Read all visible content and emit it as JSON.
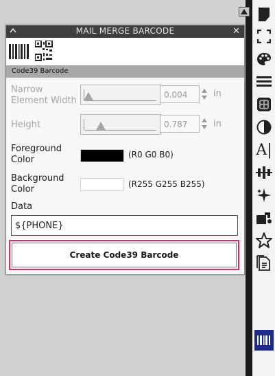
{
  "panel": {
    "title": "MAIL MERGE BARCODE",
    "type_label": "Code39 Barcode",
    "narrow": {
      "label": "Narrow Element Width",
      "value": "0.004",
      "unit": "in",
      "slider_fraction": 0.05
    },
    "height": {
      "label": "Height",
      "value": "0.787",
      "unit": "in",
      "slider_fraction": 0.2
    },
    "foreground": {
      "label": "Foreground Color",
      "color": "#000000",
      "rgb_text": "(R0 G0 B0)"
    },
    "background": {
      "label": "Background Color",
      "color": "#ffffff",
      "rgb_text": "(R255 G255 B255)"
    },
    "data_label": "Data",
    "data_value": "${PHONE}",
    "create_button": "Create Code39 Barcode"
  },
  "toolbar": {
    "icons": [
      "page-icon",
      "crop-icon",
      "palette-icon",
      "lines-icon",
      "texture-icon",
      "contrast-icon",
      "text-icon",
      "align-icon",
      "sparkle-icon",
      "fill-icon",
      "star-icon",
      "document-icon",
      "barcode-icon"
    ],
    "text_glyph": "A|"
  },
  "colors": {
    "highlight": "#c9356a",
    "active_tool": "#1e2a8a"
  }
}
